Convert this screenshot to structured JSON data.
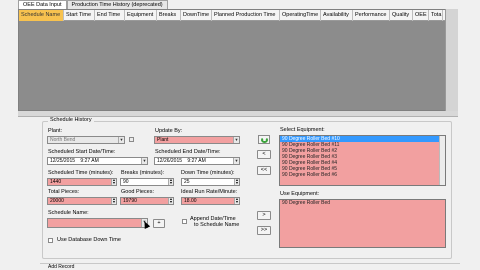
{
  "tabs": [
    {
      "label": "OEE Data Input"
    },
    {
      "label": "Production Time History (deprecated)"
    }
  ],
  "grid": {
    "columns": [
      "Schedule Name",
      "Start Time",
      "End Time",
      "Equipment",
      "Breaks",
      "DownTime",
      "Planned Production Time",
      "OperatingTime",
      "Availability",
      "Performance",
      "Quality",
      "OEE",
      "Tota"
    ]
  },
  "schedule": {
    "group_title": "Schedule History",
    "plant_label": "Plant:",
    "plant_value": "North Bend",
    "update_by_label": "Update By:",
    "update_by_value": "Plant",
    "start_label": "Scheduled Start Date/Time:",
    "start_date": "12/25/2015",
    "start_time": "9:27 AM",
    "end_label": "Scheduled End Date/Time:",
    "end_date": "12/26/2015",
    "end_time": "9:27 AM",
    "sched_time_label": "Scheduled Time (minutes):",
    "sched_time_value": "1440",
    "breaks_label": "Breaks (minutes):",
    "breaks_value": "90",
    "downtime_label": "Down Time (minutes):",
    "downtime_value": "25",
    "total_label": "Total Pieces:",
    "total_value": "20000",
    "good_label": "Good Pieces:",
    "good_value": "19790",
    "ideal_label": "Ideal Run Rate/Minute:",
    "ideal_value": "18.00",
    "name_label": "Schedule Name:",
    "name_value": "",
    "add_btn": "+",
    "use_db_label": "Use Database Down Time",
    "append_label_1": "Append Date/Time",
    "append_label_2": "to Schedule Name"
  },
  "equipment": {
    "select_label": "Select Equipment:",
    "items": [
      "90 Degree Roller Bed #10",
      "90 Degree Roller Bed #11",
      "90 Degree Roller Bed #2",
      "90 Degree Roller Bed #3",
      "90 Degree Roller Bed #4",
      "90 Degree Roller Bed #5",
      "90 Degree Roller Bed #6"
    ],
    "selected_index": 0,
    "use_label": "Use Equipment:",
    "used_items": [
      "90 Degree Roller Bed"
    ],
    "btn_left": "<",
    "btn_left_all": "<<",
    "btn_right": ">",
    "btn_right_all": ">>"
  },
  "footer": {
    "add_record_label": "Add Record"
  },
  "colors": {
    "required_field": "#f2a0a0",
    "selected_header": "#f7c24f",
    "selection": "#3399ff"
  }
}
